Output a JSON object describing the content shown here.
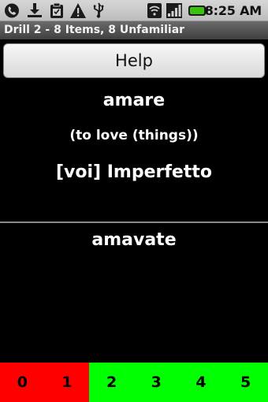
{
  "status_bar": {
    "time": "8:25 AM",
    "icons": [
      "phone-icon",
      "download-icon",
      "clipboard-icon",
      "warning-icon",
      "usb-icon",
      "wifi-icon",
      "signal-icon",
      "battery-icon"
    ]
  },
  "title_bar": {
    "title": "Drill 2 - 8 Items, 8 Unfamiliar"
  },
  "help_button": {
    "label": "Help"
  },
  "question": {
    "word": "amare",
    "meaning": "(to love (things))",
    "tense": "[voi] Imperfetto"
  },
  "answer": {
    "text": "amavate"
  },
  "ratings": [
    {
      "label": "0",
      "color": "#ff0000"
    },
    {
      "label": "1",
      "color": "#ff0000"
    },
    {
      "label": "2",
      "color": "#00ff00"
    },
    {
      "label": "3",
      "color": "#00ff00"
    },
    {
      "label": "4",
      "color": "#00ff00"
    },
    {
      "label": "5",
      "color": "#00ff00"
    }
  ]
}
